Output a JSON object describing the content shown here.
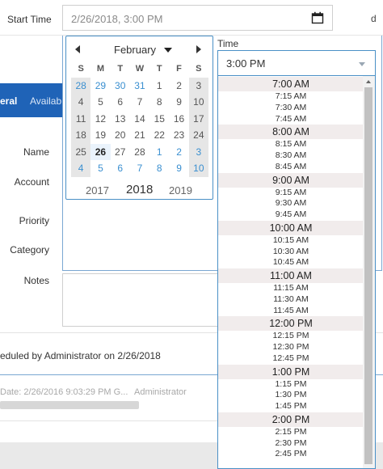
{
  "form": {
    "start_time_label": "Start Time",
    "start_time_value": "2/26/2018, 3:00 PM",
    "right_cut_text": "d",
    "tabs": {
      "general": "eral",
      "availability": "Availab"
    },
    "labels": {
      "name": "Name",
      "account": "Account",
      "priority": "Priority",
      "category": "Category",
      "notes": "Notes"
    },
    "scheduled_text": "eduled by Administrator on 2/26/2018",
    "history": {
      "date": "Date: 2/26/2016 9:03:29 PM G...",
      "user": "Administrator"
    }
  },
  "datepicker": {
    "month": "February",
    "weekdays": [
      "S",
      "M",
      "T",
      "W",
      "T",
      "F",
      "S"
    ],
    "weeks": [
      [
        "28",
        "29",
        "30",
        "31",
        "1",
        "2",
        "3"
      ],
      [
        "4",
        "5",
        "6",
        "7",
        "8",
        "9",
        "10"
      ],
      [
        "11",
        "12",
        "13",
        "14",
        "15",
        "16",
        "17"
      ],
      [
        "18",
        "19",
        "20",
        "21",
        "22",
        "23",
        "24"
      ],
      [
        "25",
        "26",
        "27",
        "28",
        "1",
        "2",
        "3"
      ],
      [
        "4",
        "5",
        "6",
        "7",
        "8",
        "9",
        "10"
      ]
    ],
    "other_month_flags": [
      [
        true,
        true,
        true,
        true,
        false,
        false,
        false
      ],
      [
        false,
        false,
        false,
        false,
        false,
        false,
        false
      ],
      [
        false,
        false,
        false,
        false,
        false,
        false,
        false
      ],
      [
        false,
        false,
        false,
        false,
        false,
        false,
        false
      ],
      [
        false,
        false,
        false,
        false,
        true,
        true,
        true
      ],
      [
        true,
        true,
        true,
        true,
        true,
        true,
        true
      ]
    ],
    "selected_day": "26",
    "years": {
      "prev": "2017",
      "current": "2018",
      "next": "2019"
    }
  },
  "timepicker": {
    "label": "Time",
    "selected": "3:00 PM",
    "hours": [
      {
        "hour": "7:00 AM",
        "subs": [
          "7:15 AM",
          "7:30 AM",
          "7:45 AM"
        ]
      },
      {
        "hour": "8:00 AM",
        "subs": [
          "8:15 AM",
          "8:30 AM",
          "8:45 AM"
        ]
      },
      {
        "hour": "9:00 AM",
        "subs": [
          "9:15 AM",
          "9:30 AM",
          "9:45 AM"
        ]
      },
      {
        "hour": "10:00 AM",
        "subs": [
          "10:15 AM",
          "10:30 AM",
          "10:45 AM"
        ]
      },
      {
        "hour": "11:00 AM",
        "subs": [
          "11:15 AM",
          "11:30 AM",
          "11:45 AM"
        ]
      },
      {
        "hour": "12:00 PM",
        "subs": [
          "12:15 PM",
          "12:30 PM",
          "12:45 PM"
        ]
      },
      {
        "hour": "1:00 PM",
        "subs": [
          "1:15 PM",
          "1:30 PM",
          "1:45 PM"
        ]
      },
      {
        "hour": "2:00 PM",
        "subs": [
          "2:15 PM",
          "2:30 PM",
          "2:45 PM"
        ]
      }
    ]
  },
  "colors": {
    "accent": "#1f63b7",
    "border_focus": "#4a90c6",
    "other_month_day": "#3a8fd0",
    "weekend_bg": "#e6e6e6",
    "hour_row_bg": "#f1ecec"
  },
  "icons": {
    "calendar": "calendar-icon",
    "dropdown": "chevron-down-icon"
  }
}
